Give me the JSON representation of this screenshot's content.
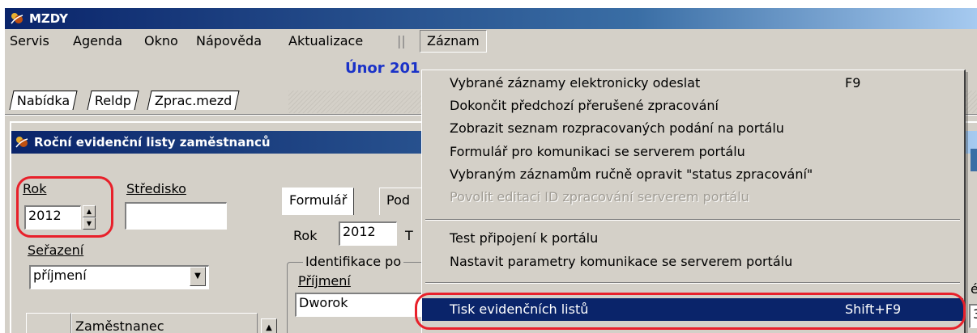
{
  "window": {
    "title": "MZDY"
  },
  "menu": {
    "items": [
      "Servis",
      "Agenda",
      "Okno",
      "Nápověda",
      "Aktualizace"
    ],
    "separator": "||",
    "active": "Záznam"
  },
  "period_title": "Únor 201",
  "tabs": [
    "Nabídka",
    "Reldp",
    "Zprac.mezd"
  ],
  "inner_window": {
    "title": "Roční evidenční listy zaměstnanců"
  },
  "left_panel": {
    "rok_label": "Rok",
    "rok_value": "2012",
    "stredisko_label": "Středisko",
    "stredisko_value": "",
    "serazeni_label": "Seřazení",
    "serazeni_value": "příjmení",
    "grid_column_header": "Zaměstnanec"
  },
  "form": {
    "tabs": [
      "Formulář",
      "Pod"
    ],
    "rok_label": "Rok",
    "rok_value": "2012",
    "rok_suffix": "T",
    "group_label": "Identifikace po",
    "prijmeni_label": "Příjmení",
    "prijmeni_value": "Dworok"
  },
  "dropdown": {
    "items": [
      {
        "label": "Vybrané záznamy elektronicky odeslat",
        "shortcut": "F9"
      },
      {
        "label": "Dokončit předchozí přerušené zpracování",
        "shortcut": ""
      },
      {
        "label": "Zobrazit seznam rozpracovaných podání na portálu",
        "shortcut": ""
      },
      {
        "label": "Formulář pro komunikaci se serverem portálu",
        "shortcut": ""
      },
      {
        "label": "Vybraným záznamům ručně opravit \"status zpracování\"",
        "shortcut": ""
      },
      {
        "label": "Povolit editaci ID  zpracování serverem portálu",
        "shortcut": ""
      },
      {
        "label": "Test připojení k portálu",
        "shortcut": ""
      },
      {
        "label": "Nastavit parametry komunikace se serverem portálu",
        "shortcut": ""
      },
      {
        "label": "Tisk evidenčních listů",
        "shortcut": "Shift+F9"
      }
    ]
  },
  "right_peek": {
    "text1": "é",
    "text2": "3"
  },
  "colors": {
    "title_bar": "#0a246a",
    "menu_background": "#d4d0c8",
    "selected_item": "#0a246a",
    "highlight_annotation": "#e8202a",
    "period_title": "#1a32c8"
  }
}
